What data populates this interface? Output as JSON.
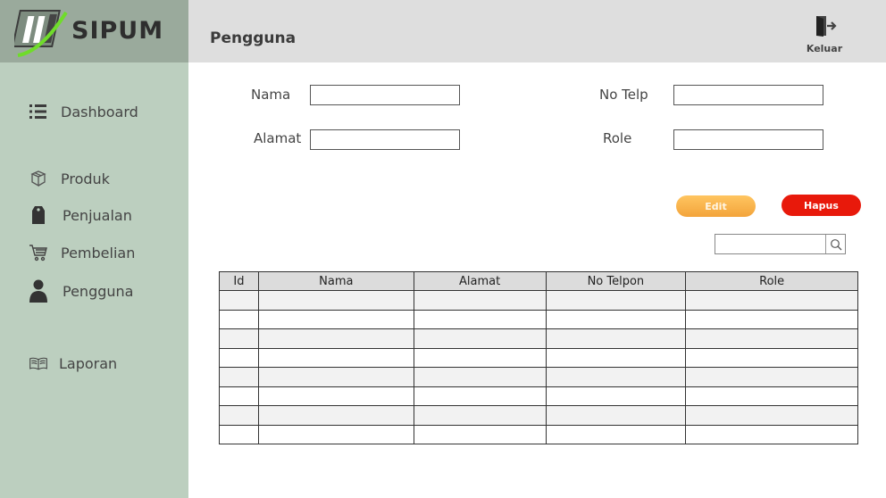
{
  "app": {
    "name": "SIPUM"
  },
  "header": {
    "title": "Pengguna",
    "logout_label": "Keluar"
  },
  "sidebar": {
    "items": [
      {
        "label": "Dashboard",
        "icon": "list-icon"
      },
      {
        "label": "Produk",
        "icon": "box-icon"
      },
      {
        "label": "Penjualan",
        "icon": "tag-icon"
      },
      {
        "label": "Pembelian",
        "icon": "cart-icon"
      },
      {
        "label": "Pengguna",
        "icon": "user-icon"
      },
      {
        "label": "Laporan",
        "icon": "book-icon"
      }
    ]
  },
  "form": {
    "nama_label": "Nama",
    "nama_value": "",
    "alamat_label": "Alamat",
    "alamat_value": "",
    "telp_label": "No Telp",
    "telp_value": "",
    "role_label": "Role",
    "role_value": ""
  },
  "actions": {
    "edit_label": "Edit",
    "hapus_label": "Hapus"
  },
  "search": {
    "value": ""
  },
  "table": {
    "columns": [
      "Id",
      "Nama",
      "Alamat",
      "No Telpon",
      "Role"
    ]
  },
  "colors": {
    "sidebar": "#bccfbf",
    "logo_bg": "#9aaa9c",
    "edit": "#f3a43b",
    "hapus": "#e8190b"
  }
}
